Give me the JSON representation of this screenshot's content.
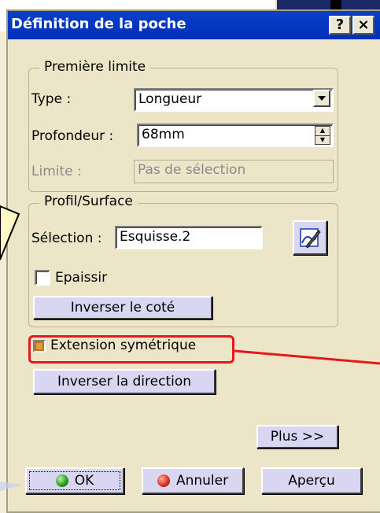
{
  "window": {
    "title": "Définition de la poche",
    "help_label": "?",
    "close_label": "×"
  },
  "premiere_limite": {
    "group_title": "Première limite",
    "type_label": "Type :",
    "type_value": "Longueur",
    "profondeur_label": "Profondeur :",
    "profondeur_value": "68mm",
    "limite_label": "Limite :",
    "limite_value": "Pas de sélection"
  },
  "profil_surface": {
    "group_title": "Profil/Surface",
    "selection_label": "Sélection :",
    "selection_value": "Esquisse.2",
    "epaissir_label": "Epaissir",
    "epaissir_checked": false,
    "inverser_cote_label": "Inverser le coté"
  },
  "extension_symetrique": {
    "label": "Extension symétrique",
    "checked": true
  },
  "inverser_direction_label": "Inverser la direction",
  "plus_label": "Plus >>",
  "footer": {
    "ok_label": "OK",
    "annuler_label": "Annuler",
    "apercu_label": "Aperçu"
  },
  "colors": {
    "dialog_bg": "#ede5c8",
    "titlebar": "#0a3fc8",
    "highlight": "#e51919",
    "button_face": "#d9d6f2"
  }
}
